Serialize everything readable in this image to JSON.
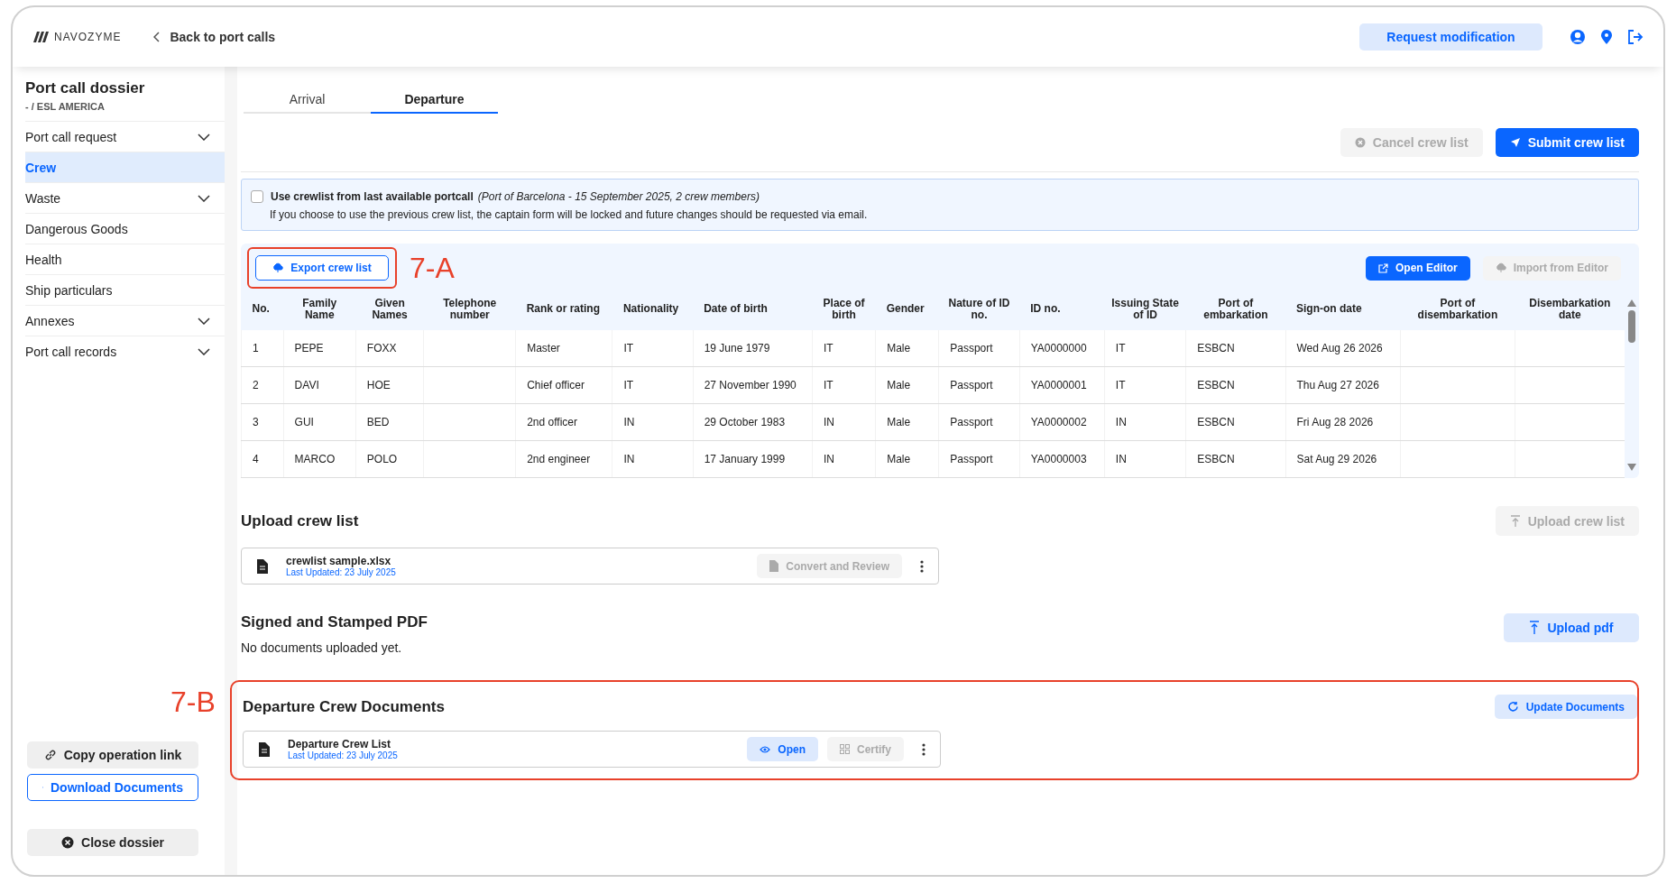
{
  "header": {
    "logo": "NAVOZYME",
    "back_link": "Back to port calls",
    "request_button": "Request modification"
  },
  "sidebar": {
    "title": "Port call dossier",
    "subtitle": "- / ESL AMERICA",
    "items": [
      {
        "label": "Port call request",
        "selected": false,
        "expandable": true
      },
      {
        "label": "Crew",
        "selected": true,
        "expandable": false
      },
      {
        "label": "Waste",
        "selected": false,
        "expandable": true
      },
      {
        "label": "Dangerous Goods",
        "selected": false,
        "expandable": false
      },
      {
        "label": "Health",
        "selected": false,
        "expandable": false
      },
      {
        "label": "Ship particulars",
        "selected": false,
        "expandable": false
      },
      {
        "label": "Annexes",
        "selected": false,
        "expandable": true
      },
      {
        "label": "Port call records",
        "selected": false,
        "expandable": true
      }
    ],
    "copy_button": "Copy operation link",
    "download_button": "Download Documents",
    "close_button": "Close dossier"
  },
  "tabs": [
    {
      "label": "Arrival",
      "selected": false
    },
    {
      "label": "Departure",
      "selected": true
    }
  ],
  "actions": [
    {
      "label": "Cancel crew list",
      "disabled": true
    },
    {
      "label": "Submit crew list",
      "disabled": false
    }
  ],
  "notice": {
    "checked": false,
    "label": "Use crewlist from last available portcall",
    "detail": "(Port of Barcelona - 15 September 2025, 2 crew members)",
    "text": "If you choose to use the previous crew list, the captain form will be locked and future changes should be requested via email."
  },
  "crew_panel": {
    "annotation": "7-A",
    "export_button": "Export crew list",
    "open_editor_button": "Open Editor",
    "import_button": {
      "label": "Import from Editor",
      "disabled": true
    },
    "table": {
      "columns": [
        "No.",
        "Family Name",
        "Given Names",
        "Telephone number",
        "Rank or rating",
        "Nationality",
        "Date of birth",
        "Place of birth",
        "Gender",
        "Nature of ID no.",
        "ID no.",
        "Issuing State of ID",
        "Port of embarkation",
        "Sign-on date",
        "Port of disembarkation",
        "Disembarkation date"
      ],
      "rows": [
        [
          "1",
          "PEPE",
          "FOXX",
          null,
          "Master",
          "IT",
          "19 June 1979",
          "IT",
          "Male",
          "Passport",
          "YA0000000",
          "IT",
          "ESBCN",
          "Wed Aug 26 2026",
          null,
          null
        ],
        [
          "2",
          "DAVI",
          "HOE",
          null,
          "Chief officer",
          "IT",
          "27 November 1990",
          "IT",
          "Male",
          "Passport",
          "YA0000001",
          "IT",
          "ESBCN",
          "Thu Aug 27 2026",
          null,
          null
        ],
        [
          "3",
          "GUI",
          "BED",
          null,
          "2nd officer",
          "IN",
          "29 October 1983",
          "IN",
          "Male",
          "Passport",
          "YA0000002",
          "IN",
          "ESBCN",
          "Fri Aug 28 2026",
          null,
          null
        ],
        [
          "4",
          "MARCO",
          "POLO",
          null,
          "2nd engineer",
          "IN",
          "17 January 1999",
          "IN",
          "Male",
          "Passport",
          "YA0000003",
          "IN",
          "ESBCN",
          "Sat Aug 29 2026",
          null,
          null
        ]
      ]
    }
  },
  "upload_section": {
    "title": "Upload crew list",
    "button": {
      "label": "Upload crew list",
      "disabled": true
    },
    "file": {
      "name": "crewlist sample.xlsx",
      "updated": "Last Updated: 23 July 2025",
      "action": {
        "label": "Convert and Review",
        "disabled": true
      }
    }
  },
  "pdf_section": {
    "title": "Signed and Stamped PDF",
    "empty_text": "No documents uploaded yet.",
    "button": {
      "label": "Upload pdf",
      "disabled": false
    }
  },
  "documents_section": {
    "annotation": "7-B",
    "title": "Departure Crew Documents",
    "button": "Update Documents",
    "file": {
      "name": "Departure Crew List",
      "updated": "Last Updated: 23 July 2025",
      "open_button": "Open",
      "certify_button": {
        "label": "Certify",
        "disabled": true
      }
    }
  }
}
